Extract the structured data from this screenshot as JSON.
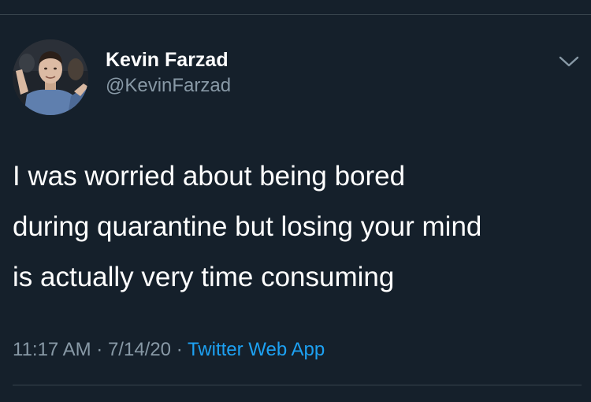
{
  "author": {
    "display_name": "Kevin Farzad",
    "handle": "@KevinFarzad"
  },
  "tweet": {
    "lines": [
      "I was worried about being bored",
      "during quarantine but losing your mind",
      "is actually very time consuming"
    ]
  },
  "meta": {
    "time": "11:17 AM",
    "separator": " · ",
    "date": "7/14/20",
    "source": "Twitter Web App"
  },
  "icons": {
    "menu": "chevron-down-icon",
    "avatar": "avatar"
  },
  "colors": {
    "background": "#15202b",
    "text": "#ffffff",
    "secondary": "#8899a6",
    "link": "#1da1f2",
    "divider": "#38444d"
  }
}
